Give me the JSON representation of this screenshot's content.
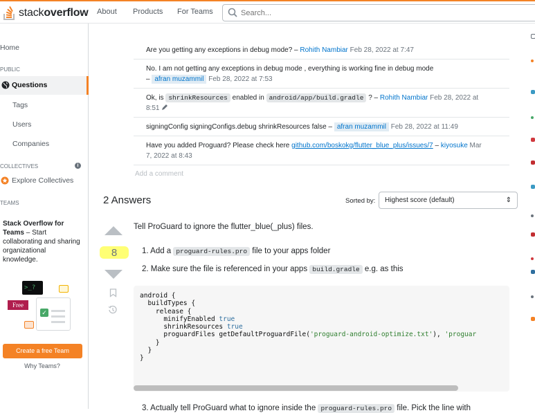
{
  "header": {
    "logo_text_prefix": "stack",
    "logo_text_bold": "overflow",
    "nav": [
      "About",
      "Products",
      "For Teams"
    ],
    "search_placeholder": "Search..."
  },
  "leftnav": {
    "home": "Home",
    "public_label": "PUBLIC",
    "questions": "Questions",
    "tags": "Tags",
    "users": "Users",
    "companies": "Companies",
    "collectives_label": "COLLECTIVES",
    "explore_collectives": "Explore Collectives",
    "teams_label": "TEAMS",
    "teams_title": "Stack Overflow for Teams",
    "teams_text": " – Start collaborating and sharing organizational knowledge.",
    "free_badge": "Free",
    "create_team_button": "Create a free Team",
    "why_teams": "Why Teams?"
  },
  "comments": [
    {
      "text": "Are you getting any exceptions in debug mode? –",
      "user": "Rohith Nambiar",
      "date": "Feb 28, 2022 at 7:47"
    },
    {
      "text": "No. I am not getting any exceptions in debug mode , everything is working fine in debug mode",
      "dash": "–",
      "user": "afran muzammil",
      "date": "Feb 28, 2022 at 7:53"
    },
    {
      "pre": "Ok, is",
      "code1": "shrinkResources",
      "mid": "enabled in",
      "code2": "android/app/build.gradle",
      "post": "? –",
      "user": "Rohith Nambiar",
      "date": "Feb 28, 2022 at",
      "date2": "8:51"
    },
    {
      "text": "signingConfig signingConfigs.debug shrinkResources false –",
      "user": "afran muzammil",
      "date": "Feb 28, 2022 at 11:49"
    },
    {
      "text": "Have you added Proguard? Please check here",
      "link": "github.com/boskokg/flutter_blue_plus/issues/7",
      "dash": "–",
      "user": "kiyosuke",
      "date": "Mar",
      "date2": "7, 2022 at 8:43"
    }
  ],
  "add_comment": "Add a comment",
  "answers": {
    "heading": "2 Answers",
    "sorted_by_label": "Sorted by:",
    "sort_value": "Highest score (default)",
    "score": "8",
    "intro": "Tell ProGuard to ignore the flutter_blue(_plus) files.",
    "step1_pre": "1. Add a",
    "step1_code": "proguard-rules.pro",
    "step1_post": "file to your apps folder",
    "step2_pre": "2. Make sure the file is referenced in your apps",
    "step2_code": "build.gradle",
    "step2_post": "e.g. as this",
    "code_lines": [
      "android {",
      "  buildTypes {",
      "    release {",
      "      minifyEnabled true",
      "      shrinkResources true",
      "      proguardFiles getDefaultProguardFile('proguard-android-optimize.txt'), 'proguar",
      "    }",
      "  }",
      "}"
    ],
    "step3_pre": "3. Actually tell ProGuard what to ignore inside the",
    "step3_code": "proguard-rules.pro",
    "step3_post": "file. Pick the line with"
  },
  "colors": {
    "accent": "#f48225",
    "link": "#0074cc",
    "highlight": "#ffff66"
  }
}
